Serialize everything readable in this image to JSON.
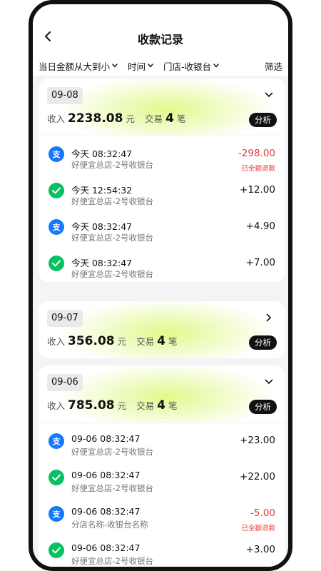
{
  "header": {
    "title": "收款记录",
    "filters": [
      {
        "label": "当日金额从大到小"
      },
      {
        "label": "时间"
      },
      {
        "label": "门店-收银台"
      }
    ],
    "filter_right": "筛选"
  },
  "labels": {
    "income": "收入",
    "unit": "元",
    "trade": "交易",
    "count_unit": "笔",
    "analyze": "分析"
  },
  "groups": [
    {
      "date": "09-08",
      "amount": "2238.08",
      "count": "4",
      "transactions": [
        {
          "method": "alipay",
          "time": "今天 08:32:47",
          "store": "好便宜总店-2号收银台",
          "amount": "-298.00",
          "note": "已全额退款"
        },
        {
          "method": "wechat",
          "time": "今天 12:54:32",
          "store": "好便宜总店-2号收银台",
          "amount": "+12.00",
          "note": ""
        },
        {
          "method": "alipay",
          "time": "今天 08:32:47",
          "store": "好便宜总店-2号收银台",
          "amount": "+4.90",
          "note": ""
        },
        {
          "method": "wechat",
          "time": "今天 08:32:47",
          "store": "好便宜总店-2号收银台",
          "amount": "+7.00",
          "note": ""
        }
      ]
    },
    {
      "date": "09-07",
      "amount": "356.08",
      "count": "4",
      "transactions": []
    },
    {
      "date": "09-06",
      "amount": "785.08",
      "count": "4",
      "transactions": [
        {
          "method": "alipay",
          "time": "09-06 08:32:47",
          "store": "好便宜总店-2号收银台",
          "amount": "+23.00",
          "note": ""
        },
        {
          "method": "wechat",
          "time": "09-06 08:32:47",
          "store": "好便宜总店-2号收银台",
          "amount": "+22.00",
          "note": ""
        },
        {
          "method": "alipay",
          "time": "09-06 08:32:47",
          "store": "分店名称-收银台名称",
          "amount": "-5.00",
          "note": "已全额退款"
        },
        {
          "method": "wechat",
          "time": "09-06 08:32:47",
          "store": "好便宜总店-2号收银台",
          "amount": "+3.00",
          "note": ""
        }
      ]
    }
  ],
  "colors": {
    "alipay": "#1677ff",
    "wechat": "#07c160",
    "refund": "#e53935",
    "highlight": "#e3f98a"
  },
  "icons": {
    "back": "chevron-left-icon",
    "dropdown": "chevron-down-icon",
    "expand": "chevron-down-icon",
    "collapsed": "chevron-right-icon",
    "alipay": "alipay-icon",
    "wechat": "wechat-pay-icon"
  }
}
